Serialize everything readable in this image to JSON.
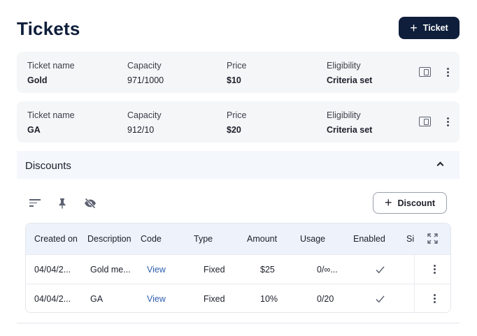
{
  "page": {
    "title": "Tickets"
  },
  "header": {
    "add_ticket_label": "Ticket"
  },
  "tickets": [
    {
      "name_label": "Ticket name",
      "name": "Gold",
      "capacity_label": "Capacity",
      "capacity": "971/1000",
      "price_label": "Price",
      "price": "$10",
      "eligibility_label": "Eligibility",
      "eligibility": "Criteria set"
    },
    {
      "name_label": "Ticket name",
      "name": "GA",
      "capacity_label": "Capacity",
      "capacity": "912/10",
      "price_label": "Price",
      "price": "$20",
      "eligibility_label": "Eligibility",
      "eligibility": "Criteria set"
    }
  ],
  "discounts": {
    "title": "Discounts",
    "add_label": "Discount",
    "columns": [
      "Created on",
      "Description",
      "Code",
      "Type",
      "Amount",
      "Usage",
      "Enabled",
      "Si"
    ],
    "rows": [
      {
        "created": "04/04/2...",
        "description": "Gold me...",
        "code": "View",
        "type": "Fixed",
        "amount": "$25",
        "usage": "0/∞..."
      },
      {
        "created": "04/04/2...",
        "description": "GA",
        "code": "View",
        "type": "Fixed",
        "amount": "10%",
        "usage": "0/20"
      }
    ]
  },
  "icons": {
    "add": "plus-icon",
    "ticket_action": "ticket-card-icon",
    "menu": "more-vertical-icon",
    "collapse": "chevron-up-icon",
    "sort": "sort-icon",
    "pin": "pin-icon",
    "hide": "eye-off-icon",
    "expand": "fullscreen-icon",
    "enabled": "check-icon"
  },
  "colors": {
    "primary": "#0f1e3a",
    "link": "#2f5fae",
    "card_bg": "#f5f6f8",
    "header_bg": "#edf2fb"
  }
}
